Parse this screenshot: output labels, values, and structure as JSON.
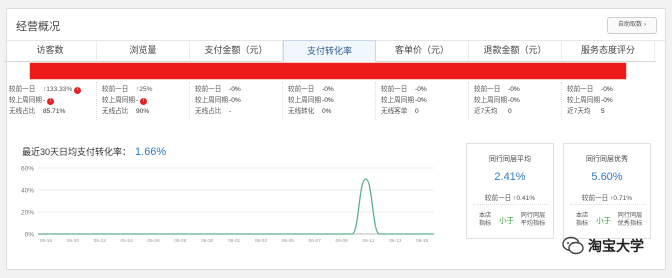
{
  "header": {
    "title": "经营概况",
    "refresh_label": "自助取数"
  },
  "tabs": [
    {
      "label": "访客数"
    },
    {
      "label": "浏览量"
    },
    {
      "label": "支付金额（元）"
    },
    {
      "label": "支付转化率",
      "active": true
    },
    {
      "label": "客单价（元）"
    },
    {
      "label": "退款金额（元）"
    },
    {
      "label": "服务态度评分"
    }
  ],
  "metrics": [
    {
      "rows": [
        {
          "label": "较前一日",
          "value": "↑133.33%",
          "badge": true
        },
        {
          "label": "较上周同期",
          "value": "-",
          "badge": true
        },
        {
          "label": "无线占比",
          "value": "85.71%"
        }
      ]
    },
    {
      "rows": [
        {
          "label": "较前一日",
          "value": "↑25%"
        },
        {
          "label": "较上周同期",
          "value": "-",
          "badge": true
        },
        {
          "label": "无线占比",
          "value": "90%"
        }
      ]
    },
    {
      "rows": [
        {
          "label": "较前一日",
          "value": "-0%"
        },
        {
          "label": "较上周同期",
          "value": "-0%"
        },
        {
          "label": "无线占比",
          "value": "-"
        }
      ]
    },
    {
      "rows": [
        {
          "label": "较前一日",
          "value": "-0%"
        },
        {
          "label": "较上周同期",
          "value": "-0%"
        },
        {
          "label": "无线转化",
          "value": "0%"
        }
      ]
    },
    {
      "rows": [
        {
          "label": "较前一日",
          "value": "-0%"
        },
        {
          "label": "较上周同期",
          "value": "-0%"
        },
        {
          "label": "无线客单",
          "value": "0"
        }
      ]
    },
    {
      "rows": [
        {
          "label": "较前一日",
          "value": "-0%"
        },
        {
          "label": "较上周同期",
          "value": "-0%"
        },
        {
          "label": "近7天均",
          "value": "0"
        }
      ]
    },
    {
      "rows": [
        {
          "label": "较前一日",
          "value": "-0%"
        },
        {
          "label": "较上周同期",
          "value": "-0%"
        },
        {
          "label": "近7天均",
          "value": "5"
        }
      ]
    }
  ],
  "chart": {
    "title": "最近30天日均支付转化率：",
    "rate": "1.66%"
  },
  "chart_data": {
    "type": "line",
    "title": "最近30天日均支付转化率：1.66%",
    "x": [
      "05-15",
      "05-17",
      "05-19",
      "05-21",
      "05-23",
      "05-25",
      "05-27",
      "05-29",
      "05-31",
      "06-02",
      "06-04",
      "06-06",
      "06-08",
      "06-10",
      "06-12",
      "06-14",
      "06-16",
      "06-18",
      "06-20",
      "06-22",
      "06-24",
      "06-26",
      "06-28",
      "06-30",
      "07-02",
      "07-04",
      "07-06",
      "07-08",
      "07-10",
      "07-12"
    ],
    "x_tick_labels": [
      "05-16",
      "05-20",
      "05-22",
      "05-24",
      "05-26",
      "05-28",
      "05-30",
      "06-01",
      "06-03",
      "06-05",
      "06-07",
      "06-09",
      "06-11",
      "06-13",
      "06-15"
    ],
    "series": [
      {
        "values": [
          0,
          0,
          0,
          0,
          0,
          0,
          0,
          0,
          0,
          0,
          0,
          0,
          0,
          0,
          0,
          0,
          0,
          0,
          0,
          0,
          0,
          0,
          0,
          0,
          50,
          0,
          0,
          0,
          0,
          0
        ]
      }
    ],
    "ylim": [
      0,
      60
    ],
    "yticks": [
      "0%",
      "20%",
      "40%",
      "60%"
    ],
    "grid": true
  },
  "peers": [
    {
      "title": "同行同层平均",
      "value": "2.41%",
      "compare_label": "较前一日",
      "compare_value": "↑0.41%",
      "self_label": "本店\n指标",
      "relation": "小于",
      "peer_label": "同行同层\n平均指标"
    },
    {
      "title": "同行同层优秀",
      "value": "5.60%",
      "compare_label": "较前一日",
      "compare_value": "↑0.71%",
      "self_label": "本店\n指标",
      "relation": "小于",
      "peer_label": "同行同层\n优秀指标"
    }
  ],
  "watermark": {
    "text": "淘宝大学"
  },
  "colors": {
    "accent": "#2d7bc5",
    "line": "#5fb08a",
    "red_band": "#ee1b1b",
    "green": "#3aa63a"
  }
}
